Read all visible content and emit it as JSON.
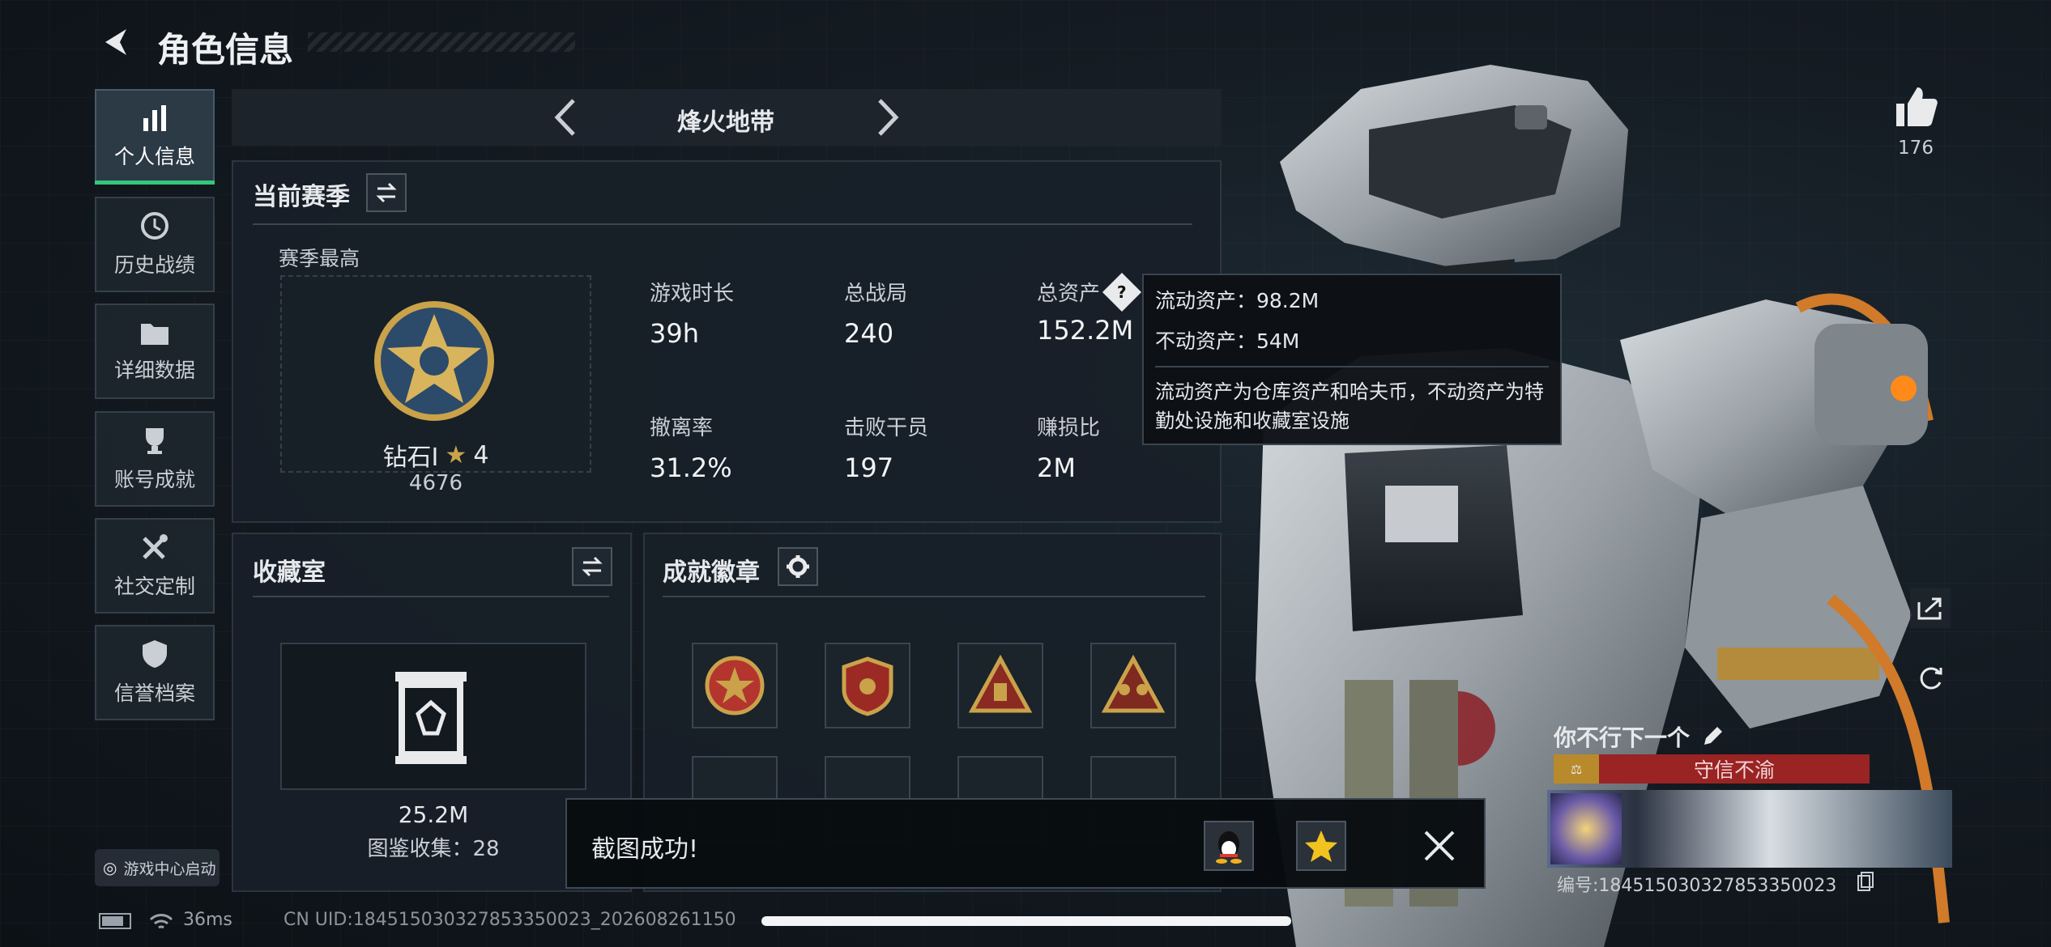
{
  "header": {
    "title": "角色信息"
  },
  "sidebar": {
    "items": [
      {
        "label": "个人信息"
      },
      {
        "label": "历史战绩"
      },
      {
        "label": "详细数据"
      },
      {
        "label": "账号成就"
      },
      {
        "label": "社交定制"
      },
      {
        "label": "信誉档案"
      }
    ],
    "game_center": "游戏中心启动"
  },
  "mode_selector": {
    "label": "烽火地带"
  },
  "season": {
    "title": "当前赛季",
    "best_label": "赛季最高",
    "rank_name": "钻石Ⅰ",
    "rank_stars": "4",
    "rank_points": "4676",
    "stats": [
      {
        "label": "游戏时长",
        "value": "39h"
      },
      {
        "label": "总战局",
        "value": "240"
      },
      {
        "label": "总资产",
        "value": "152.2M"
      },
      {
        "label": "撤离率",
        "value": "31.2%"
      },
      {
        "label": "击败干员",
        "value": "197"
      },
      {
        "label": "赚损比",
        "value": "2M"
      }
    ]
  },
  "tooltip": {
    "liquid": "流动资产：98.2M",
    "fixed": "不动资产：54M",
    "desc": "流动资产为仓库资产和哈夫币，不动资产为特勤处设施和收藏室设施"
  },
  "collection": {
    "title": "收藏室",
    "value": "25.2M",
    "count": "图鉴收集：28"
  },
  "achievements": {
    "title": "成就徽章"
  },
  "toast": {
    "message": "截图成功!"
  },
  "likes": {
    "count": "176"
  },
  "profile": {
    "name": "你不行下一个",
    "tag": "守信不渝",
    "id": "编号:184515030327853350023"
  },
  "status": {
    "ping": "36ms",
    "uid": "CN UID:184515030327853350023_202608261150"
  },
  "colors": {
    "accent": "#34c77b",
    "tag_red": "#9a2323",
    "gold": "#c9a24a"
  }
}
